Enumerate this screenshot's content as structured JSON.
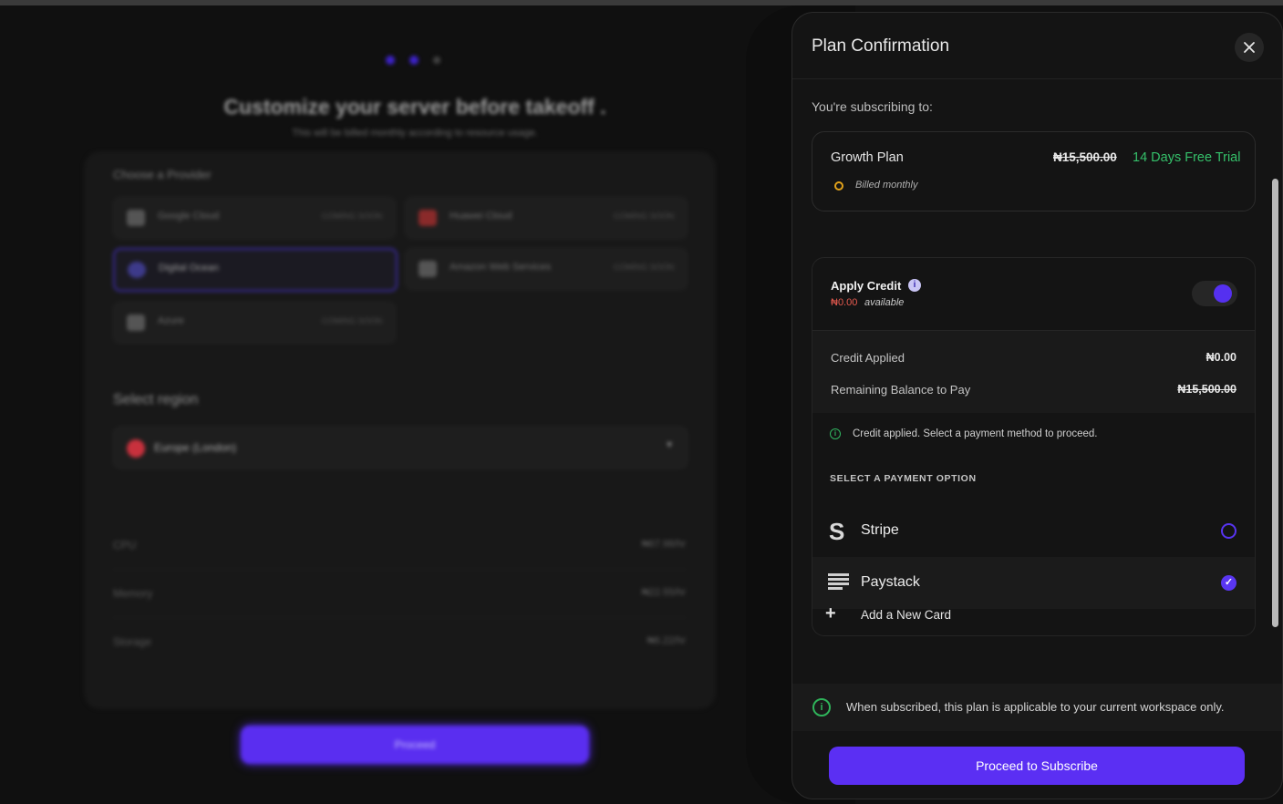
{
  "background_page": {
    "title": "Customize your server before takeoff .",
    "subtitle": "This will be billed monthly according to resource usage.",
    "provider_section_label": "Choose a Provider",
    "providers": [
      {
        "name": "Google Cloud",
        "tag": "COMING SOON"
      },
      {
        "name": "Huawei Cloud",
        "tag": "COMING SOON"
      },
      {
        "name": "Digital Ocean",
        "tag": ""
      },
      {
        "name": "Amazon Web Services",
        "tag": "COMING SOON"
      },
      {
        "name": "Azure",
        "tag": "COMING SOON"
      }
    ],
    "region_label": "Select region",
    "region_value": "Europe (London)",
    "resources": [
      {
        "label": "CPU",
        "value": "₦67.98/hr"
      },
      {
        "label": "Memory",
        "value": "₦22.55/hr"
      },
      {
        "label": "Storage",
        "value": "₦6.22/hr"
      }
    ],
    "proceed_label": "Proceed"
  },
  "modal": {
    "title": "Plan Confirmation",
    "subscribing_label": "You're subscribing to:",
    "plan": {
      "name": "Growth Plan",
      "price": "₦15,500.00",
      "trial": "14 Days Free Trial",
      "billing": "Billed monthly"
    },
    "credit": {
      "title": "Apply Credit",
      "amount": "₦0.00",
      "available_label": "available",
      "toggle_on": true,
      "applied_label": "Credit Applied",
      "applied_value": "₦0.00",
      "balance_label": "Remaining Balance to Pay",
      "balance_value": "₦15,500.00",
      "status_text": "Credit applied. Select a payment method to proceed."
    },
    "payment": {
      "section_label": "SELECT A PAYMENT OPTION",
      "options": [
        {
          "name": "Stripe",
          "selected": false
        },
        {
          "name": "Paystack",
          "selected": true
        }
      ],
      "add_card": "Add a New Card"
    },
    "notice": "When subscribed, this plan is applicable to your current workspace only.",
    "subscribe_label": "Proceed to Subscribe"
  },
  "colors": {
    "accent": "#5b2ff3",
    "success": "#35c06a",
    "warning": "#e2a21a",
    "danger": "#e85a4f"
  }
}
